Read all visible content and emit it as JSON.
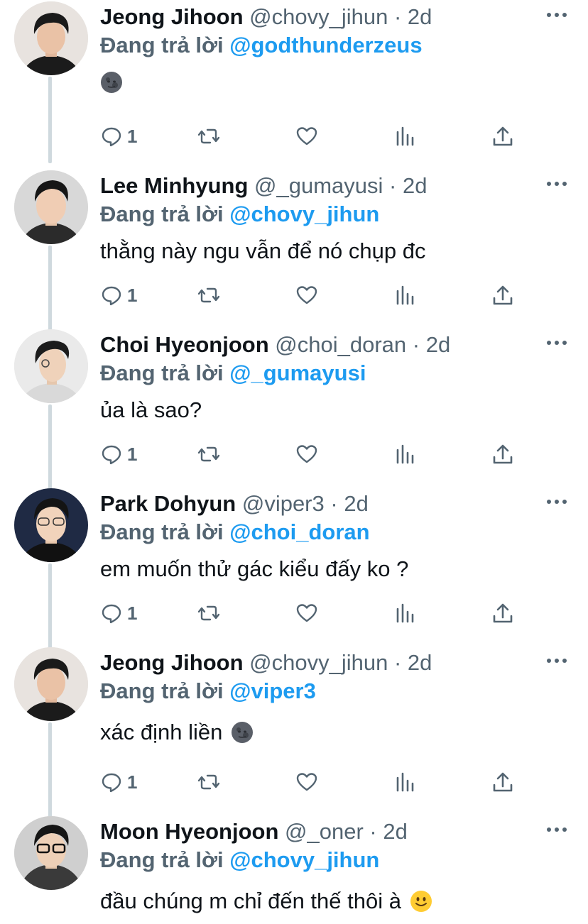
{
  "reply_prefix": "Đang trả lời",
  "icons": {
    "reply": "speech-bubble-icon",
    "retweet": "retweet-icon",
    "like": "heart-icon",
    "views": "bar-chart-icon",
    "share": "share-upload-icon",
    "more": "ellipsis-icon",
    "emoji_moon": "new-moon-face-emoji",
    "emoji_smile": "slightly-smiling-face-emoji"
  },
  "colors": {
    "link": "#1d9bf0",
    "muted": "#536471",
    "text": "#0f1419",
    "thread_line": "#cfd9de"
  },
  "tweets": [
    {
      "name": "Jeong Jihoon",
      "handle": "@chovy_jihun",
      "dot": "·",
      "time": "2d",
      "replying_to": "@godthunderzeus",
      "text": "",
      "emoji": "new-moon-face-emoji",
      "reply_count": "1"
    },
    {
      "name": "Lee Minhyung",
      "handle": "@_gumayusi",
      "dot": "·",
      "time": "2d",
      "replying_to": "@chovy_jihun",
      "text": "thằng này ngu vẫn để nó chụp đc",
      "emoji": "",
      "reply_count": "1"
    },
    {
      "name": "Choi Hyeonjoon",
      "handle": "@choi_doran",
      "dot": "·",
      "time": "2d",
      "replying_to": "@_gumayusi",
      "text": "ủa là sao?",
      "emoji": "",
      "reply_count": "1"
    },
    {
      "name": "Park Dohyun",
      "handle": "@viper3",
      "dot": "·",
      "time": "2d",
      "replying_to": "@choi_doran",
      "text": "em muốn thử gác kiểu đấy ko ?",
      "emoji": "",
      "reply_count": "1"
    },
    {
      "name": "Jeong Jihoon",
      "handle": "@chovy_jihun",
      "dot": "·",
      "time": "2d",
      "replying_to": "@viper3",
      "text": "xác định liền",
      "emoji": "new-moon-face-emoji",
      "reply_count": "1"
    },
    {
      "name": "Moon Hyeonjoon",
      "handle": "@_oner",
      "dot": "·",
      "time": "2d",
      "replying_to": "@chovy_jihun",
      "text": "đầu chúng m chỉ đến thế thôi à",
      "emoji": "slightly-smiling-face-emoji",
      "reply_count": ""
    }
  ]
}
